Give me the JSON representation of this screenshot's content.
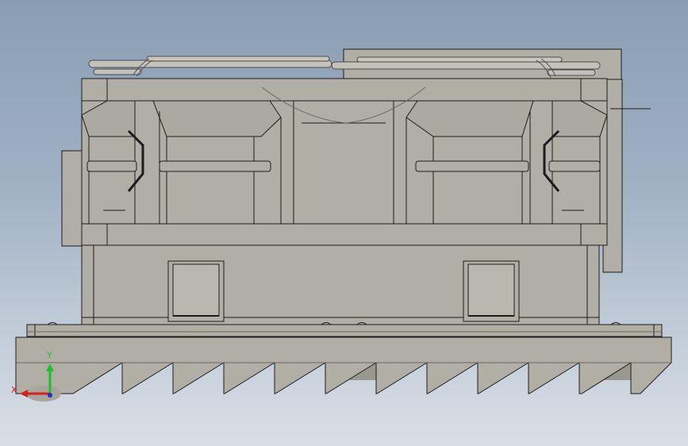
{
  "viewport": {
    "background_top": "#8a9db3",
    "background_bottom": "#d9dfe6"
  },
  "model": {
    "fill_color": "#b1aea6",
    "edge_color": "#1c1c1c",
    "shadow_color": "#9a978f"
  },
  "triad": {
    "x_label": "X",
    "y_label": "Y",
    "x_color": "#d42020",
    "y_color": "#1fbf2a",
    "z_color": "#2030d0"
  }
}
